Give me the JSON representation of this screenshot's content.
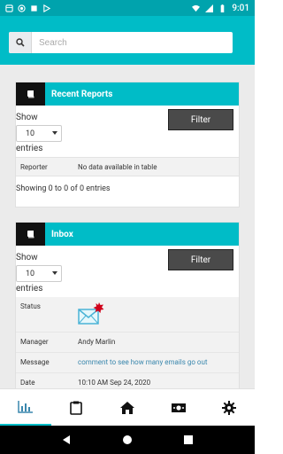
{
  "statusbar": {
    "time": "9:01"
  },
  "search": {
    "placeholder": "Search"
  },
  "recent_reports": {
    "title": "Recent Reports",
    "show_label": "Show",
    "entries_value": "10",
    "entries_label": "entries",
    "filter_label": "Filter",
    "columns": [
      "Reporter",
      "No data available in table"
    ],
    "info": "Showing 0 to 0 of 0 entries"
  },
  "inbox": {
    "title": "Inbox",
    "show_label": "Show",
    "entries_value": "10",
    "entries_label": "entries",
    "filter_label": "Filter",
    "rows": [
      {
        "key": "Status",
        "value": ""
      },
      {
        "key": "Manager",
        "value": "Andy Marlin"
      },
      {
        "key": "Message",
        "value": "comment to see how many emails go out"
      },
      {
        "key": "Date",
        "value": "10:10 AM Sep 24, 2020"
      }
    ]
  },
  "colors": {
    "accent": "#00bcc7",
    "statusbar": "#00a3ad",
    "dark": "#111111"
  }
}
